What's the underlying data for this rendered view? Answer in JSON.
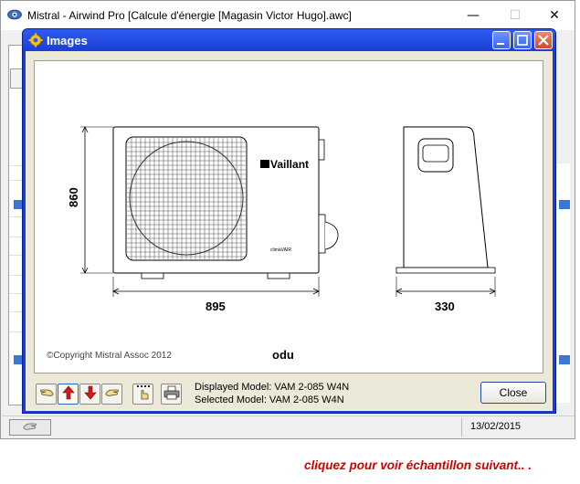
{
  "main_window": {
    "title": "Mistral - Airwind Pro [Calcule d'énergie [Magasin Victor Hugo].awc]",
    "controls": {
      "minimize": "—",
      "maximize": "☐",
      "close": "✕"
    },
    "app_icon": "eye-icon"
  },
  "status_bar": {
    "date": "13/02/2015",
    "button_icon": "hand-icon"
  },
  "dialog": {
    "title": "Images",
    "title_icon": "gear-icon",
    "image": {
      "caption": "odu",
      "copyright": "Copyright Mistral Assoc 2012",
      "brand": "Vaillant",
      "sub_brand": "climaVAIR",
      "height_label": "860",
      "width_label": "895",
      "depth_label": "330"
    },
    "toolbar": {
      "buttons": [
        {
          "name": "hand-left-button",
          "icon": "hand-left-icon"
        },
        {
          "name": "previous-button",
          "icon": "arrow-up-icon"
        },
        {
          "name": "next-button",
          "icon": "arrow-down-icon"
        },
        {
          "name": "hand-right-button",
          "icon": "hand-right-icon"
        },
        {
          "name": "select-button",
          "icon": "hand-select-icon"
        },
        {
          "name": "print-button",
          "icon": "printer-icon"
        }
      ]
    },
    "displayed_model": "Displayed Model: VAM 2-085 W4N",
    "selected_model": "Selected Model: VAM 2-085 W4N",
    "close_label": "Close"
  },
  "footer": {
    "link_text": "cliquez pour voir échantillon suivant.. ."
  },
  "colors": {
    "dialog_frame": "#1b3ed0",
    "footer_text": "#d40000",
    "dialog_body": "#ece9d8"
  }
}
